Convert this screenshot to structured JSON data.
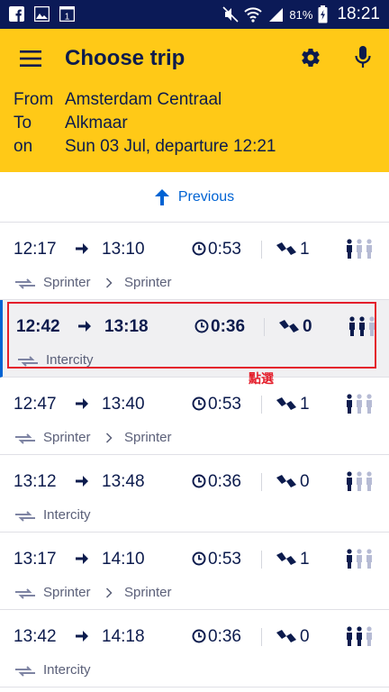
{
  "status_bar": {
    "battery": "81%",
    "time": "18:21"
  },
  "header": {
    "title": "Choose trip",
    "from_label": "From",
    "from_value": "Amsterdam Centraal",
    "to_label": "To",
    "to_value": "Alkmaar",
    "on_label": "on",
    "on_value": "Sun 03 Jul, departure 12:21"
  },
  "previous_label": "Previous",
  "trips": [
    {
      "dep": "12:17",
      "arr": "13:10",
      "duration": "0:53",
      "transfers": "1",
      "modality": "Sprinter",
      "modality2": "Sprinter",
      "crowd": 1
    },
    {
      "dep": "12:42",
      "arr": "13:18",
      "duration": "0:36",
      "transfers": "0",
      "modality": "Intercity",
      "modality2": "",
      "crowd": 2
    },
    {
      "dep": "12:47",
      "arr": "13:40",
      "duration": "0:53",
      "transfers": "1",
      "modality": "Sprinter",
      "modality2": "Sprinter",
      "crowd": 1
    },
    {
      "dep": "13:12",
      "arr": "13:48",
      "duration": "0:36",
      "transfers": "0",
      "modality": "Intercity",
      "modality2": "",
      "crowd": 1
    },
    {
      "dep": "13:17",
      "arr": "14:10",
      "duration": "0:53",
      "transfers": "1",
      "modality": "Sprinter",
      "modality2": "Sprinter",
      "crowd": 1
    },
    {
      "dep": "13:42",
      "arr": "14:18",
      "duration": "0:36",
      "transfers": "0",
      "modality": "Intercity",
      "modality2": "",
      "crowd": 2
    }
  ],
  "annotation": "點選",
  "colors": {
    "header_bg": "#ffc917",
    "status_bg": "#0b1a57",
    "accent": "#0063d3",
    "text": "#0c1b4d",
    "annotation": "#e41e2b"
  }
}
